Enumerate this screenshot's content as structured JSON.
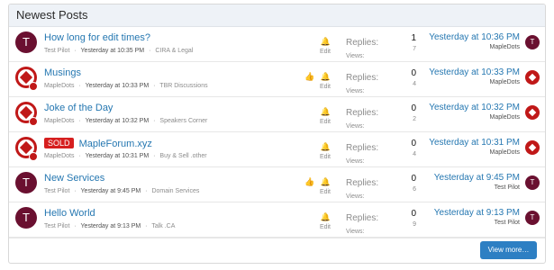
{
  "panel": {
    "title": "Newest Posts",
    "view_more": "View more…"
  },
  "labels": {
    "replies": "Replies:",
    "views": "Views:",
    "edit": "Edit"
  },
  "posts": [
    {
      "title": "How long for edit times?",
      "prefix": "",
      "author": "Test Pilot",
      "date": "Yesterday at 10:35 PM",
      "forum": "CIRA & Legal",
      "replies": "1",
      "views": "7",
      "last_time": "Yesterday at 10:36 PM",
      "last_user": "MapleDots",
      "avatar": "T",
      "liked": false
    },
    {
      "title": "Musings",
      "prefix": "",
      "author": "MapleDots",
      "date": "Yesterday at 10:33 PM",
      "forum": "TBR Discussions",
      "replies": "0",
      "views": "4",
      "last_time": "Yesterday at 10:33 PM",
      "last_user": "MapleDots",
      "avatar": "maple",
      "liked": true
    },
    {
      "title": "Joke of the Day",
      "prefix": "",
      "author": "MapleDots",
      "date": "Yesterday at 10:32 PM",
      "forum": "Speakers Corner",
      "replies": "0",
      "views": "2",
      "last_time": "Yesterday at 10:32 PM",
      "last_user": "MapleDots",
      "avatar": "maple",
      "liked": false
    },
    {
      "title": "MapleForum.xyz",
      "prefix": "SOLD",
      "author": "MapleDots",
      "date": "Yesterday at 10:31 PM",
      "forum": "Buy & Sell .other",
      "replies": "0",
      "views": "4",
      "last_time": "Yesterday at 10:31 PM",
      "last_user": "MapleDots",
      "avatar": "maple",
      "liked": false
    },
    {
      "title": "New Services",
      "prefix": "",
      "author": "Test Pilot",
      "date": "Yesterday at 9:45 PM",
      "forum": "Domain Services",
      "replies": "0",
      "views": "6",
      "last_time": "Yesterday at 9:45 PM",
      "last_user": "Test Pilot",
      "avatar": "T",
      "liked": true
    },
    {
      "title": "Hello World",
      "prefix": "",
      "author": "Test Pilot",
      "date": "Yesterday at 9:13 PM",
      "forum": "Talk .CA",
      "replies": "0",
      "views": "9",
      "last_time": "Yesterday at 9:13 PM",
      "last_user": "Test Pilot",
      "avatar": "T",
      "liked": false
    }
  ]
}
